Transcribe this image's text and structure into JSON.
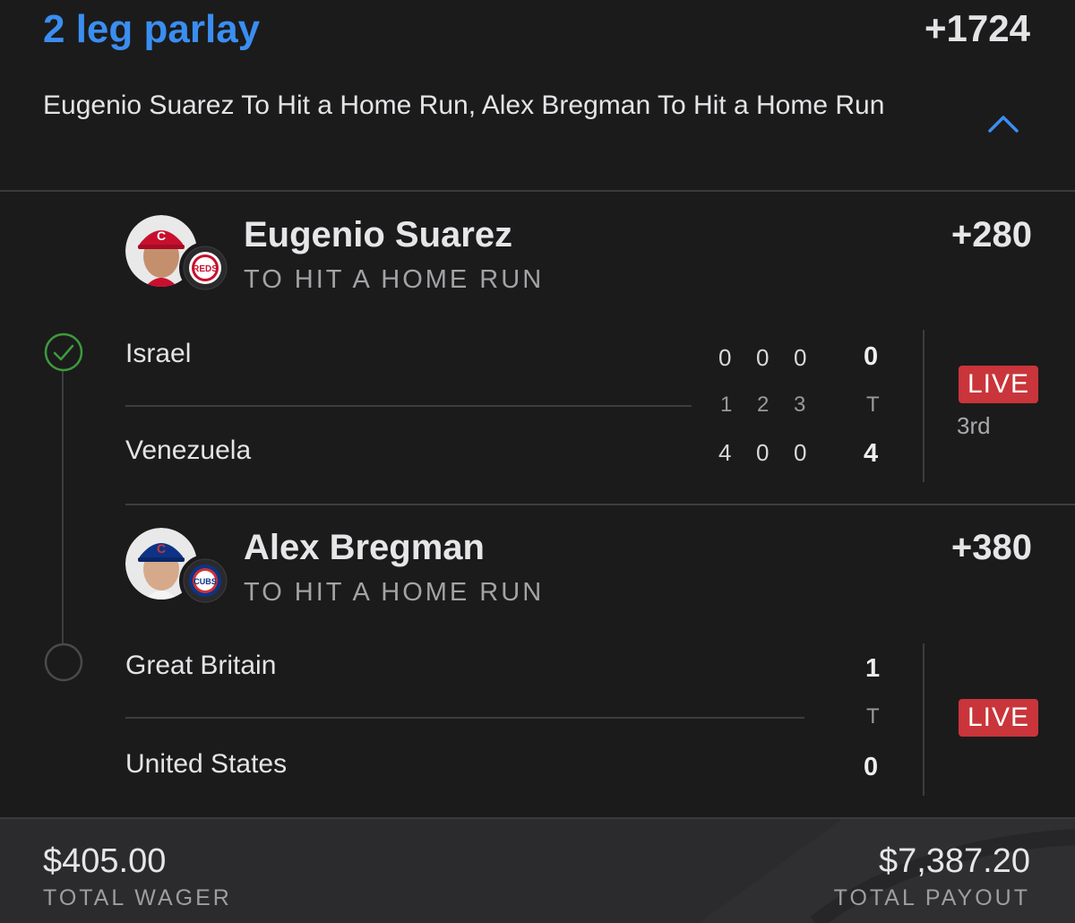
{
  "parlay": {
    "title": "2 leg parlay",
    "odds": "+1724",
    "summary": "Eugenio Suarez To Hit a Home Run, Alex Bregman To Hit a Home Run"
  },
  "legs": [
    {
      "player": "Eugenio Suarez",
      "market": "TO HIT A HOME RUN",
      "odds": "+280",
      "status": "won",
      "team_logo_text": "REDS",
      "cap_letter": "C",
      "game": {
        "away": "Israel",
        "home": "Venezuela",
        "innings": [
          "1",
          "2",
          "3"
        ],
        "away_runs": [
          "0",
          "0",
          "0"
        ],
        "home_runs": [
          "4",
          "0",
          "0"
        ],
        "total_label": "T",
        "away_total": "0",
        "home_total": "4",
        "live": "LIVE",
        "period": "3rd"
      }
    },
    {
      "player": "Alex Bregman",
      "market": "TO HIT A HOME RUN",
      "odds": "+380",
      "status": "pending",
      "team_logo_text": "CUBS",
      "cap_letter": "C",
      "game": {
        "away": "Great Britain",
        "home": "United States",
        "total_label": "T",
        "away_total": "1",
        "home_total": "0",
        "live": "LIVE"
      }
    }
  ],
  "footer": {
    "wager": "$405.00",
    "wager_label": "TOTAL WAGER",
    "payout": "$7,387.20",
    "payout_label": "TOTAL PAYOUT"
  },
  "colors": {
    "accent": "#3a8ef0",
    "live": "#c9353a",
    "check": "#3f9a3c",
    "background": "#1b1b1c"
  }
}
